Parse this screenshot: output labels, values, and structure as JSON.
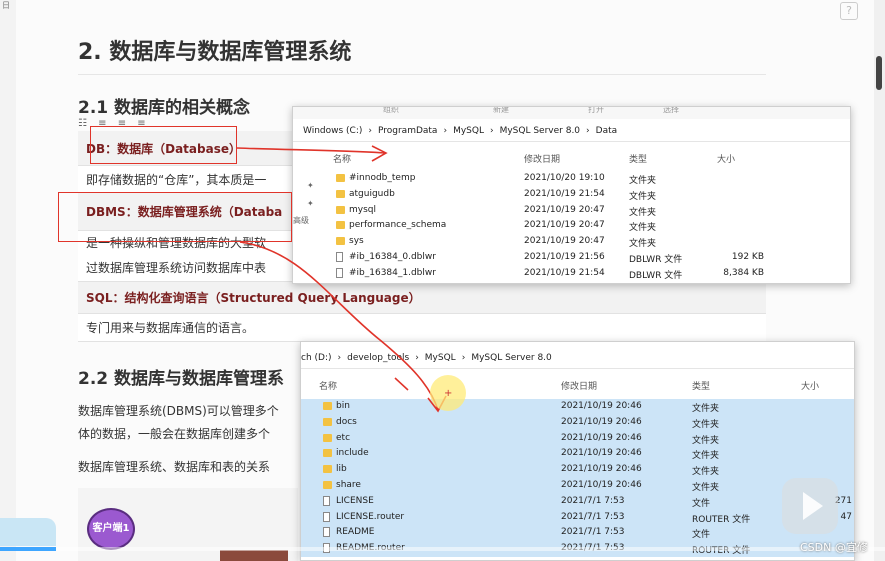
{
  "corner": {
    "text": "日"
  },
  "help": {
    "label": "?"
  },
  "doc": {
    "h2": "2. 数据库与数据库管理系统",
    "h3_1": "2.1 数据库的相关概念",
    "toolbar_icons": "☷ ≡ ≡ ≡",
    "table": [
      {
        "type": "head",
        "text": "DB：数据库（Database）"
      },
      {
        "type": "body",
        "text": "即存储数据的“仓库”，其本质是一"
      },
      {
        "type": "head",
        "text": "DBMS：数据库管理系统（Databa"
      },
      {
        "type": "body",
        "text": "是一种操纵和管理数据库的大型软"
      },
      {
        "type": "body",
        "text": "过数据库管理系统访问数据库中表"
      },
      {
        "type": "head",
        "text": "SQL：结构化查询语言（Structured Query Language）"
      },
      {
        "type": "body",
        "text": "专门用来与数据库通信的语言。"
      }
    ],
    "h3_2": "2.2 数据库与数据库管理系",
    "para1": "数据库管理系统(DBMS)可以管理多个",
    "para2": "体的数据，一般会在数据库创建多个",
    "para3": "数据库管理系统、数据库和表的关系",
    "client_node": "客户端1"
  },
  "win1": {
    "toolbar": [
      "组织",
      "新建",
      "打开",
      "选择"
    ],
    "breadcrumb": [
      "Windows (C:)",
      "ProgramData",
      "MySQL",
      "MySQL Server 8.0",
      "Data"
    ],
    "side_label": "高级",
    "columns": [
      "名称",
      "修改日期",
      "类型",
      "大小"
    ],
    "rows": [
      {
        "icon": "folder",
        "name": "#innodb_temp",
        "date": "2021/10/20 19:10",
        "type": "文件夹",
        "size": ""
      },
      {
        "icon": "folder",
        "name": "atguigudb",
        "date": "2021/10/19 21:54",
        "type": "文件夹",
        "size": ""
      },
      {
        "icon": "folder",
        "name": "mysql",
        "date": "2021/10/19 20:47",
        "type": "文件夹",
        "size": ""
      },
      {
        "icon": "folder",
        "name": "performance_schema",
        "date": "2021/10/19 20:47",
        "type": "文件夹",
        "size": ""
      },
      {
        "icon": "folder",
        "name": "sys",
        "date": "2021/10/19 20:47",
        "type": "文件夹",
        "size": ""
      },
      {
        "icon": "file",
        "name": "#ib_16384_0.dblwr",
        "date": "2021/10/19 21:56",
        "type": "DBLWR 文件",
        "size": "192 KB"
      },
      {
        "icon": "file",
        "name": "#ib_16384_1.dblwr",
        "date": "2021/10/19 21:54",
        "type": "DBLWR 文件",
        "size": "8,384 KB"
      }
    ]
  },
  "win2": {
    "breadcrumb": [
      "ch (D:)",
      "develop_tools",
      "MySQL",
      "MySQL Server 8.0"
    ],
    "columns": [
      "名称",
      "修改日期",
      "类型",
      "大小"
    ],
    "rows": [
      {
        "icon": "folder",
        "name": "bin",
        "date": "2021/10/19 20:46",
        "type": "文件夹",
        "size": ""
      },
      {
        "icon": "folder",
        "name": "docs",
        "date": "2021/10/19 20:46",
        "type": "文件夹",
        "size": ""
      },
      {
        "icon": "folder",
        "name": "etc",
        "date": "2021/10/19 20:46",
        "type": "文件夹",
        "size": ""
      },
      {
        "icon": "folder",
        "name": "include",
        "date": "2021/10/19 20:46",
        "type": "文件夹",
        "size": ""
      },
      {
        "icon": "folder",
        "name": "lib",
        "date": "2021/10/19 20:46",
        "type": "文件夹",
        "size": ""
      },
      {
        "icon": "folder",
        "name": "share",
        "date": "2021/10/19 20:46",
        "type": "文件夹",
        "size": ""
      },
      {
        "icon": "file",
        "name": "LICENSE",
        "date": "2021/7/1 7:53",
        "type": "文件",
        "size": "271"
      },
      {
        "icon": "file",
        "name": "LICENSE.router",
        "date": "2021/7/1 7:53",
        "type": "ROUTER 文件",
        "size": "47"
      },
      {
        "icon": "file",
        "name": "README",
        "date": "2021/7/1 7:53",
        "type": "文件",
        "size": ""
      },
      {
        "icon": "file",
        "name": "README.router",
        "date": "2021/7/1 7:53",
        "type": "ROUTER 文件",
        "size": ""
      }
    ]
  },
  "watermark": "CSDN @宜修",
  "video": {
    "progress": 0.063
  },
  "colors": {
    "accent": "#e0342a",
    "selection": "#cce4f7",
    "folder": "#f3c242",
    "dbHeader": "#7a1f1f"
  }
}
